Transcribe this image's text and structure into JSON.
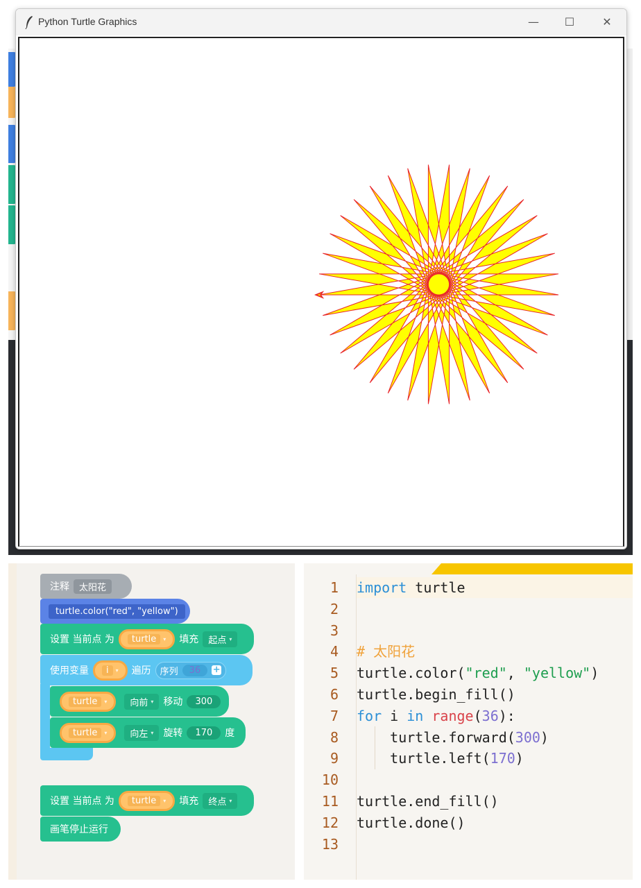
{
  "window": {
    "title": "Python Turtle Graphics",
    "minimize_glyph": "—",
    "maximize_glyph": "☐",
    "close_glyph": "✕"
  },
  "turtle_drawing": {
    "pen_color": "#e8262a",
    "fill_color": "#ffff00",
    "steps": 36,
    "forward_distance": 300,
    "left_angle": 170
  },
  "blocks": {
    "comment": {
      "label": "注释",
      "value": "太阳花"
    },
    "color_call": "turtle.color(\"red\", \"yellow\")",
    "set_start": {
      "label": "设置 当前点 为",
      "object": "turtle",
      "action": "填充",
      "point": "起点"
    },
    "loop": {
      "label": "使用变量",
      "var": "i",
      "iterate": "遍历",
      "seq_label": "序列",
      "seq_value": "36",
      "plus": "+"
    },
    "forward": {
      "object": "turtle",
      "direction": "向前",
      "action": "移动",
      "value": "300"
    },
    "left": {
      "object": "turtle",
      "direction": "向左",
      "action": "旋转",
      "value": "170",
      "unit": "度"
    },
    "set_end": {
      "label": "设置 当前点 为",
      "object": "turtle",
      "action": "填充",
      "point": "终点"
    },
    "stop": {
      "label": "画笔停止运行"
    }
  },
  "code": {
    "lines": [
      {
        "n": "1",
        "parts": [
          [
            "kw",
            "import"
          ],
          [
            "p",
            " turtle"
          ]
        ]
      },
      {
        "n": "2",
        "parts": []
      },
      {
        "n": "3",
        "parts": []
      },
      {
        "n": "4",
        "parts": [
          [
            "cmt",
            "# 太阳花"
          ]
        ]
      },
      {
        "n": "5",
        "parts": [
          [
            "p",
            "turtle.color("
          ],
          [
            "str",
            "\"red\""
          ],
          [
            "p",
            ", "
          ],
          [
            "str",
            "\"yellow\""
          ],
          [
            "p",
            ")"
          ]
        ]
      },
      {
        "n": "6",
        "parts": [
          [
            "p",
            "turtle.begin_fill()"
          ]
        ]
      },
      {
        "n": "7",
        "parts": [
          [
            "kw",
            "for"
          ],
          [
            "p",
            " i "
          ],
          [
            "kw",
            "in"
          ],
          [
            "p",
            " "
          ],
          [
            "fn",
            "range"
          ],
          [
            "p",
            "("
          ],
          [
            "num",
            "36"
          ],
          [
            "p",
            "):"
          ]
        ]
      },
      {
        "n": "8",
        "parts": [
          [
            "p",
            "    turtle.forward("
          ],
          [
            "num",
            "300"
          ],
          [
            "p",
            ")"
          ]
        ]
      },
      {
        "n": "9",
        "parts": [
          [
            "p",
            "    turtle.left("
          ],
          [
            "num",
            "170"
          ],
          [
            "p",
            ")"
          ]
        ]
      },
      {
        "n": "10",
        "parts": []
      },
      {
        "n": "11",
        "parts": [
          [
            "p",
            "turtle.end_fill()"
          ]
        ]
      },
      {
        "n": "12",
        "parts": [
          [
            "p",
            "turtle.done()"
          ]
        ]
      },
      {
        "n": "13",
        "parts": []
      }
    ]
  }
}
